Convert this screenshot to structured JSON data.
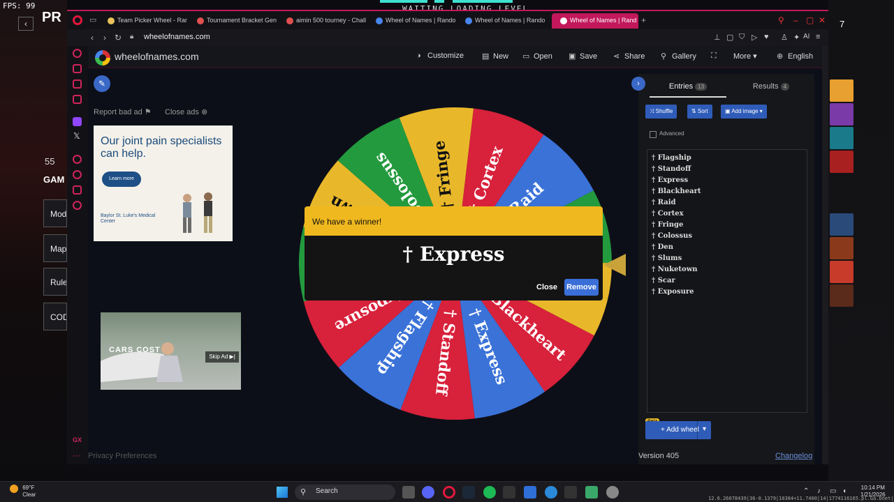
{
  "overlay": {
    "fps_label": "FPS:  99",
    "waiting_text": "WAITING  LOADING LEVEL",
    "game_title": "PR",
    "game_count": "55",
    "game_heading": "GAM",
    "game_menu": [
      "Mod",
      "Map",
      "Rule",
      "COD"
    ],
    "right_number": "7"
  },
  "tabs": [
    {
      "label": "Team Picker Wheel - Rand",
      "color": "#e8c25a"
    },
    {
      "label": "Tournament Bracket Gene",
      "color": "#e05050"
    },
    {
      "label": "aimin 500 tourney - Chall",
      "color": "#e05050"
    },
    {
      "label": "Wheel of Names | Random",
      "color": "#4885ed"
    },
    {
      "label": "Wheel of Names | Random",
      "color": "#4885ed"
    },
    {
      "label": "Wheel of Names | Rand",
      "color": "#ffffff",
      "active": true
    }
  ],
  "address": {
    "url": "wheelofnames.com",
    "ai_label": "AI"
  },
  "header": {
    "site_name": "wheelofnames.com",
    "menu": [
      {
        "label": "Customize",
        "icon": "palette-icon",
        "glyph": "◑"
      },
      {
        "label": "New",
        "icon": "new-file-icon",
        "glyph": "▤"
      },
      {
        "label": "Open",
        "icon": "folder-icon",
        "glyph": "▭"
      },
      {
        "label": "Save",
        "icon": "save-icon",
        "glyph": "▣"
      },
      {
        "label": "Share",
        "icon": "share-icon",
        "glyph": "⋖"
      },
      {
        "label": "Gallery",
        "icon": "search-icon",
        "glyph": "⚲"
      },
      {
        "label": "",
        "icon": "fullscreen-icon",
        "glyph": "⛶"
      },
      {
        "label": "More ▾",
        "icon": "more-icon",
        "glyph": ""
      },
      {
        "label": "English",
        "icon": "globe-icon",
        "glyph": "⊕"
      }
    ]
  },
  "ads": {
    "report_label": "Report bad ad ⚑",
    "close_label": "Close ads ⊗",
    "ad1_headline": "Our joint pain specialists can help.",
    "ad1_button": "Learn more",
    "ad1_brand": "Baylor St. Luke's Medical Center",
    "ad2_text": "CARS COST",
    "ad2_skip": "Skip Ad ▶|"
  },
  "wheel": {
    "slices": [
      {
        "label": "† Fringe",
        "color": "#e8b82a"
      },
      {
        "label": "† Cortex",
        "color": "#d8213b"
      },
      {
        "label": "† Raid",
        "color": "#3a72d8"
      },
      {
        "label": "† Den",
        "color": "#239a3e"
      },
      {
        "label": "† Slums",
        "color": "#e8b82a"
      },
      {
        "label": "† Blackheart",
        "color": "#d8213b"
      },
      {
        "label": "† Express",
        "color": "#3a72d8"
      },
      {
        "label": "† Standoff",
        "color": "#d8213b"
      },
      {
        "label": "† Flagship",
        "color": "#3a72d8"
      },
      {
        "label": "† Exposure",
        "color": "#d8213b"
      },
      {
        "label": "† Scar",
        "color": "#239a3e"
      },
      {
        "label": "† Nuketown",
        "color": "#e8b82a"
      },
      {
        "label": "† Colossus",
        "color": "#239a3e"
      }
    ],
    "pointer_color": "#c9a23a"
  },
  "winner": {
    "title": "We have a winner!",
    "name": "† Express",
    "close_label": "Close",
    "remove_label": "Remove"
  },
  "panel": {
    "entries_tab": "Entries",
    "entries_count": "13",
    "results_tab": "Results",
    "results_count": "4",
    "shuffle_label": "⤨ Shuffle",
    "sort_label": "⇅ Sort",
    "add_image_label": "▣ Add image ▾",
    "advanced_label": "Advanced",
    "entries": [
      "† Flagship",
      "† Standoff",
      "† Express",
      "† Blackheart",
      "† Raid",
      "† Cortex",
      "† Fringe",
      "† Colossus",
      "† Den",
      "† Slums",
      "† Nuketown",
      "† Scar",
      "† Exposure"
    ],
    "beta_label": "Beta",
    "add_wheel_label": "+  Add wheel",
    "version": "Version 405",
    "changelog": "Changelog"
  },
  "footer": {
    "privacy": "Privacy Preferences"
  },
  "taskbar": {
    "temp": "69°F",
    "condition": "Clear",
    "search_label": "Search",
    "time": "10:14 PM",
    "date": "1/21/2026",
    "build_text": "12.6.26078439|36-0.1379|10384+11.7400|14|1774116165.pl.Ga.bnet|10001228007"
  },
  "colors": {
    "accent": "#c2185b",
    "brand_blue": "#3a68c6",
    "winner_yellow": "#f0b81f"
  }
}
